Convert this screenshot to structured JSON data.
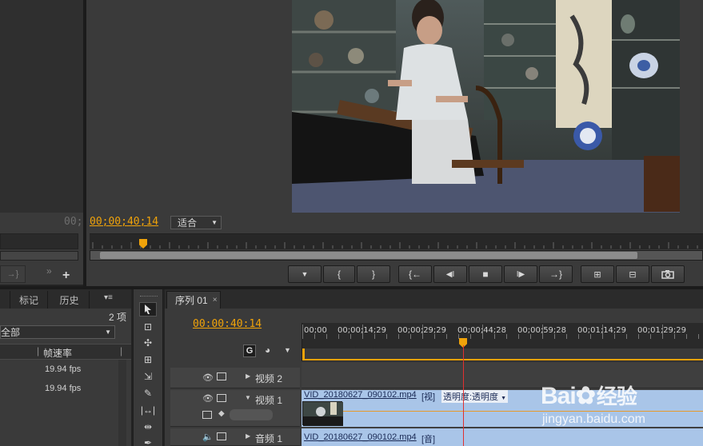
{
  "source_monitor": {
    "timecode": "00;",
    "add_icon": "+"
  },
  "program_monitor": {
    "timecode": "00;00;40;14",
    "fit_label": "适合",
    "controls": [
      "▼",
      "{",
      "}",
      "{←",
      "◀I",
      "■",
      "I▶",
      "→}"
    ]
  },
  "project_panel": {
    "tabs": [
      "标记",
      "历史"
    ],
    "item_count": "2 项",
    "filter": "全部",
    "column_header": "帧速率",
    "rows": [
      "19.94 fps",
      "19.94 fps"
    ]
  },
  "sequence": {
    "tab_label": "序列 01",
    "timecode": "00:00:40:14",
    "ruler": [
      "00;00",
      "00;00;14;29",
      "00;00;29;29",
      "00;00;44;28",
      "00;00;59;28",
      "00;01;14;29",
      "00;01;29;29"
    ],
    "tracks": {
      "video2": "视频 2",
      "video1": "视频 1",
      "audio1": "音频 1"
    },
    "video_clip": {
      "name": "VID_20180627_090102.mp4",
      "tag": "[视]",
      "effect": "透明度:透明度"
    },
    "audio_clip": {
      "name": "VID_20180627_090102.mp4",
      "tag": "[音]"
    }
  },
  "watermark": {
    "brand": "Bai",
    "brand2": "经验",
    "url": "jingyan.baidu.com"
  },
  "colors": {
    "accent": "#f0a30a",
    "playhead": "#e03030",
    "clip_video": "#a9c5e8"
  }
}
